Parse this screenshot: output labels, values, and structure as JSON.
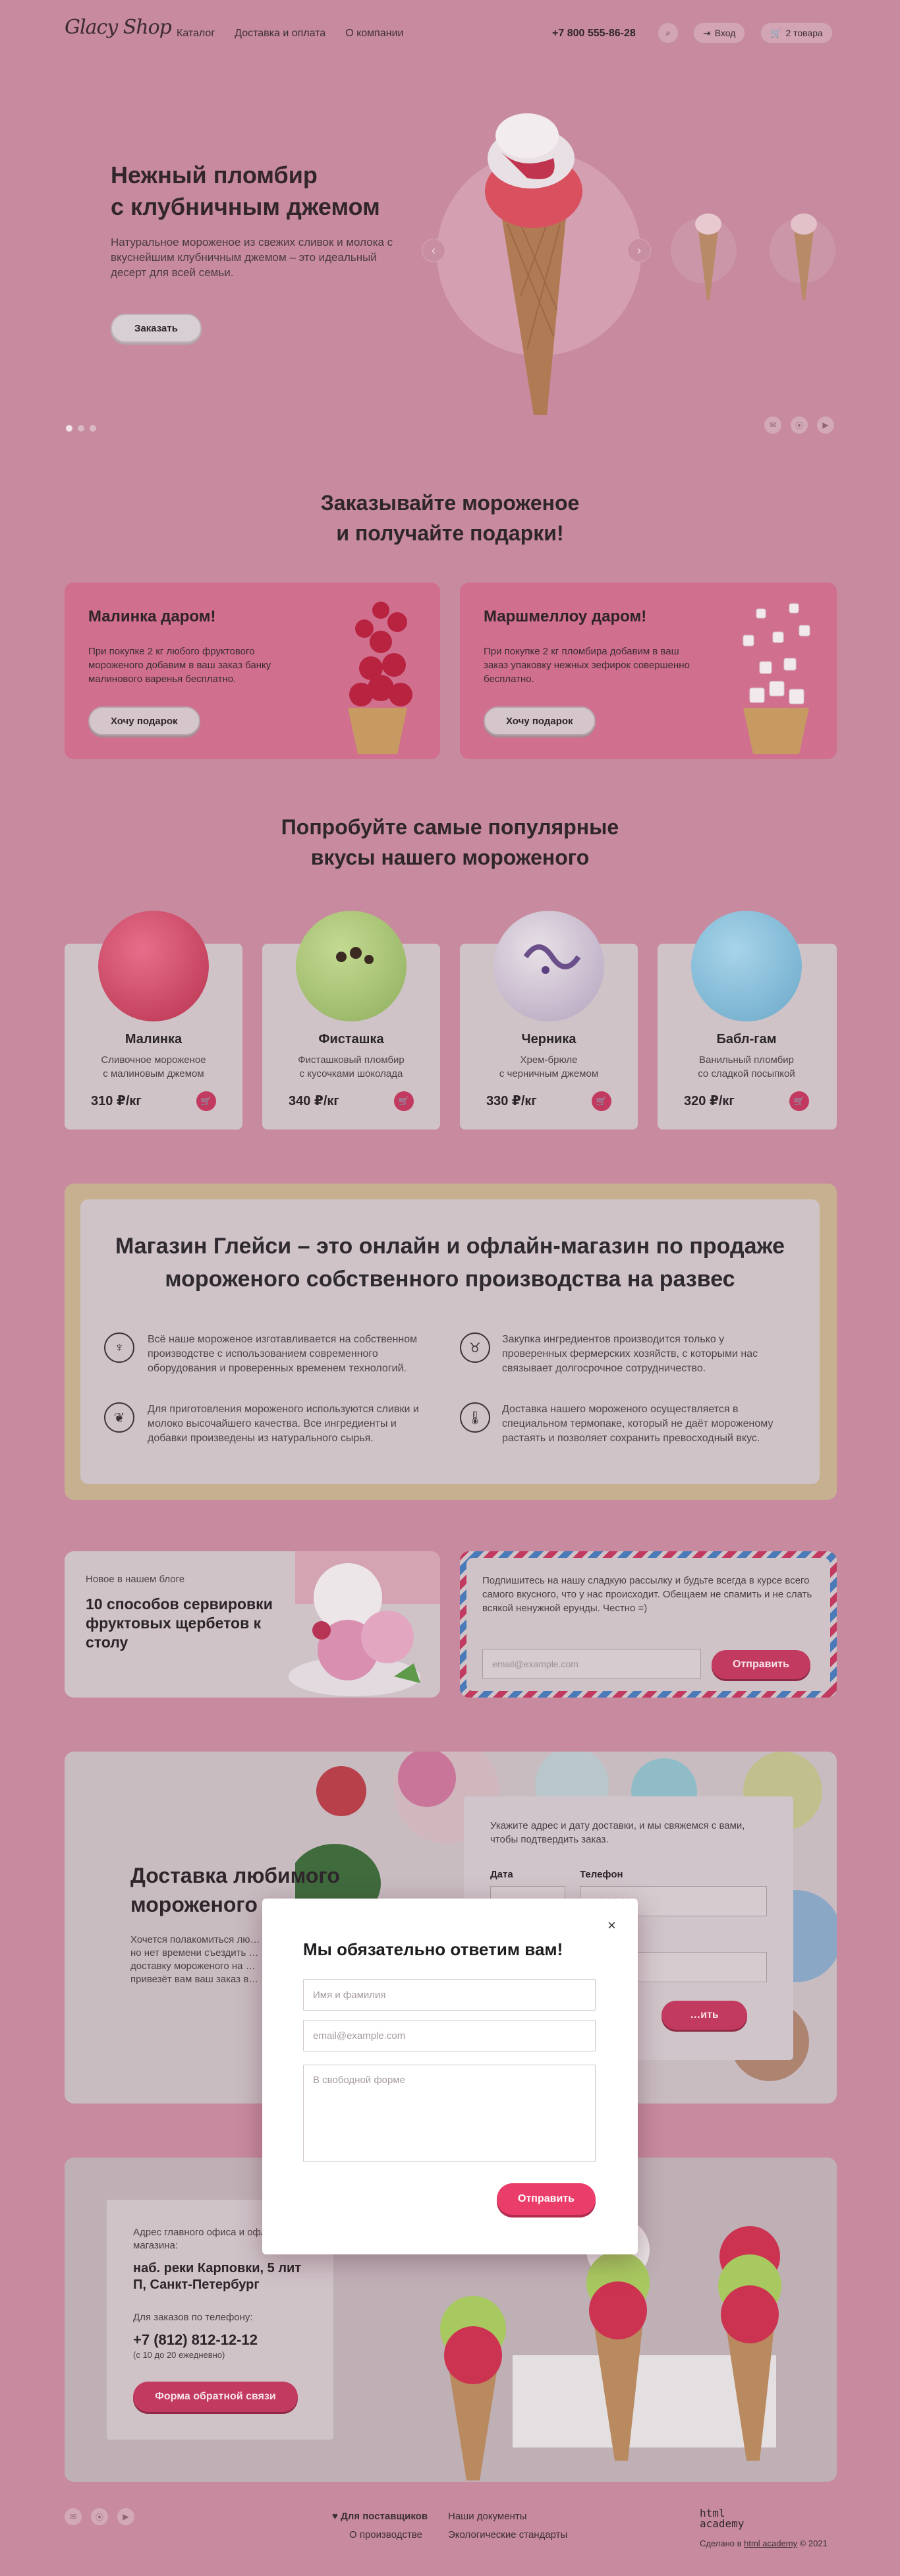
{
  "header": {
    "logo": "Glacy Shop",
    "nav": [
      "Каталог",
      "Доставка и оплата",
      "О компании"
    ],
    "phone": "+7 800 555-86-28",
    "login": "Вход",
    "cart": "2 товара"
  },
  "hero": {
    "title_line1": "Нежный пломбир",
    "title_line2": "с клубничным джемом",
    "text": "Натуральное мороженое из свежих сливок и молока с вкуснейшим клубничным джемом – это идеальный десерт для всей семьи.",
    "button": "Заказать"
  },
  "promo": {
    "title_line1": "Заказывайте мороженое",
    "title_line2": "и получайте подарки!",
    "cards": [
      {
        "title": "Малинка даром!",
        "text": "При покупке 2 кг любого фруктового мороженого добавим в ваш заказ банку малинового варенья бесплатно.",
        "button": "Хочу подарок"
      },
      {
        "title": "Маршмеллоу даром!",
        "text": "При покупке 2 кг пломбира добавим в ваш заказ упаковку нежных зефирок совершенно бесплатно.",
        "button": "Хочу подарок"
      }
    ]
  },
  "popular": {
    "title_line1": "Попробуйте самые популярные",
    "title_line2": "вкусы нашего мороженого",
    "items": [
      {
        "name": "Малинка",
        "desc1": "Сливочное мороженое",
        "desc2": "с малиновым джемом",
        "price": "310 ₽/кг",
        "color": "#d4536f"
      },
      {
        "name": "Фисташка",
        "desc1": "Фисташковый пломбир",
        "desc2": "с кусочками шоколада",
        "price": "340 ₽/кг",
        "color": "#a8c27a"
      },
      {
        "name": "Черника",
        "desc1": "Хрем-брюле",
        "desc2": "с черничным джемом",
        "price": "330 ₽/кг",
        "color": "#cbbfd0"
      },
      {
        "name": "Бабл-гам",
        "desc1": "Ванильный пломбир",
        "desc2": "со сладкой посыпкой",
        "price": "320 ₽/кг",
        "color": "#86bcd6"
      }
    ]
  },
  "about": {
    "title_line1": "Магазин Глейси – это онлайн и офлайн-магазин по продаже",
    "title_line2": "мороженого собственного производства на развес",
    "features": [
      {
        "icon": "ice-cream-icon",
        "text": "Всё наше мороженое изготавливается на собственном производстве с использованием современного оборудования и проверенных временем технологий."
      },
      {
        "icon": "cow-icon",
        "text": "Закупка ингредиентов производится только у проверенных фермерских хозяйств, с которыми нас связывает долгосрочное сотрудничество."
      },
      {
        "icon": "leaf-icon",
        "text": "Для приготовления мороженого используются сливки и молоко высочайшего качества. Все ингредиенты и добавки произведены из натурального сырья."
      },
      {
        "icon": "thermometer-icon",
        "text": "Доставка нашего мороженого осуществляется в специальном термопаке, который не даёт мороженому растаять и позволяет сохранить превосходный вкус."
      }
    ]
  },
  "blog": {
    "label": "Новое в нашем блоге",
    "title": "10 способов сервировки фруктовых щербетов к столу"
  },
  "subscribe": {
    "text": "Подпишитесь на нашу сладкую рассылку и будьте всегда в курсе всего самого вкусного, что у нас происходит. Обещаем не спамить и не слать всякой ненужной ерунды. Честно =)",
    "placeholder": "email@example.com",
    "button": "Отправить"
  },
  "delivery": {
    "title_line1": "Доставка любимого",
    "title_line2": "мороженого",
    "text": "Хочется полакомиться лю… но нет времени съездить … доставку мороженого на … привезёт вам ваш заказ в…",
    "form_text": "Укажите адрес и дату доставки, и мы свяжемся с вами, чтобы подтвердить заказ.",
    "date_label": "Дата",
    "phone_label": "Телефон",
    "phone_value": "…9-00-00",
    "button": "…ить"
  },
  "contacts": {
    "office_label": "Адрес главного офиса и офлайн-магазина:",
    "address": "наб. реки Карповки, 5 лит П, Санкт-Петербург",
    "phone_label": "Для заказов по телефону:",
    "phone": "+7 (812) 812-12-12",
    "hours": "(с 10 до 20 ежедневно)",
    "button": "Форма обратной связи"
  },
  "footer": {
    "suppliers": "Для поставщиков",
    "production": "О производстве",
    "documents": "Наши документы",
    "standards": "Экологические стандарты",
    "made_by_logo": "html academy",
    "made_by": "Сделано в",
    "made_by_link": "html academy",
    "copyright": "© 2021"
  },
  "modal": {
    "title": "Мы обязательно ответим вам!",
    "name_placeholder": "Имя и фамилия",
    "email_placeholder": "email@example.com",
    "message_placeholder": "В свободной форме",
    "submit": "Отправить",
    "close_icon": "close-icon"
  }
}
